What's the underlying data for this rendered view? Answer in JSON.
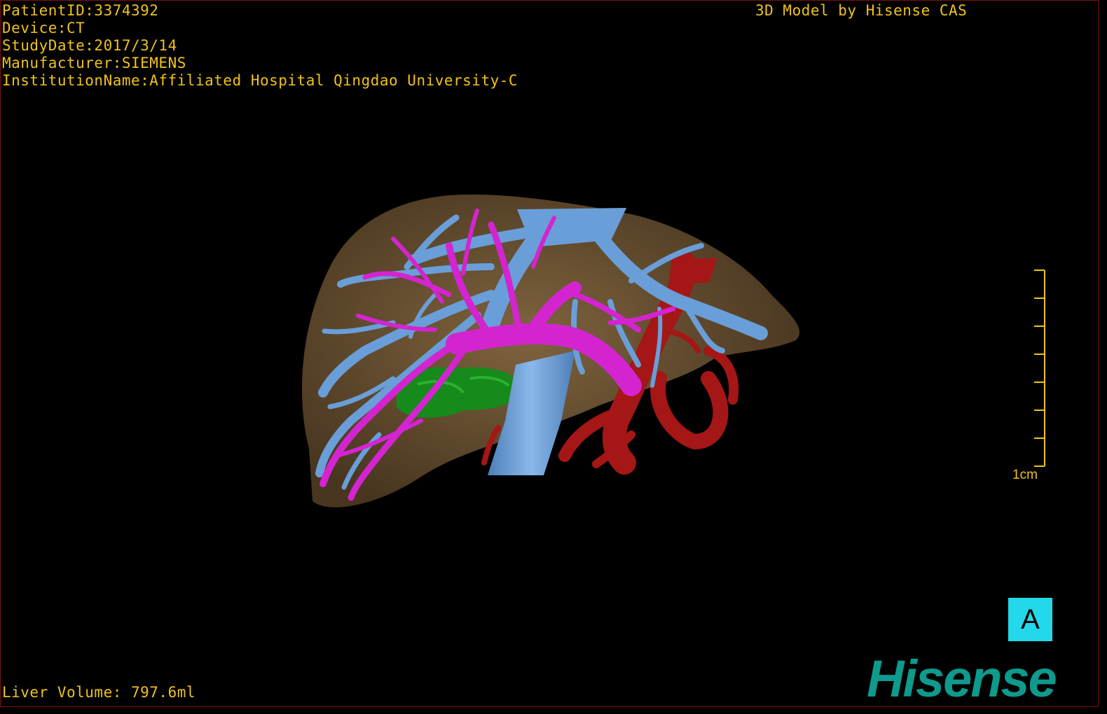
{
  "viewer": {
    "patient_id": "PatientID:3374392",
    "device": "Device:CT",
    "study_date": "StudyDate:2017/3/14",
    "manufacturer": "Manufacturer:SIEMENS",
    "institution": "InstitutionName:Affiliated Hospital Qingdao University-C",
    "credit": "3D Model by Hisense CAS",
    "liver_volume": "Liver Volume: 797.6ml",
    "scale_label": "1cm",
    "orientation_label": "A",
    "logo": "Hisense"
  },
  "colors": {
    "text": "#f0c21a",
    "liver": "#6e5434",
    "hepatic_vein": "#6a9ed8",
    "portal_vein": "#d424d0",
    "artery": "#a51616",
    "tumor": "#168a1a",
    "orientation_button": "#22d8ea",
    "logo": "#0e9a8c"
  }
}
